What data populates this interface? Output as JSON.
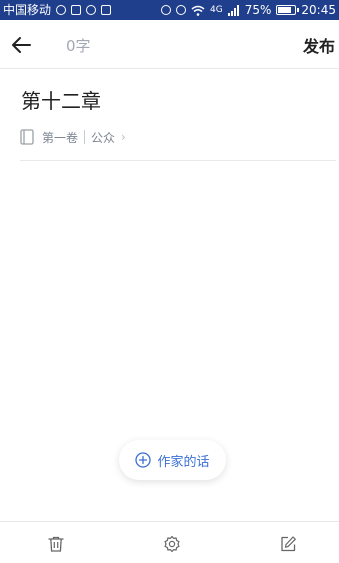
{
  "status_bar": {
    "carrier": "中国移动",
    "signal": "4G",
    "battery": "75%",
    "time": "20:45"
  },
  "top_bar": {
    "word_count": "0字",
    "publish_label": "发布"
  },
  "chapter": {
    "title": "第十二章",
    "volume": "第一卷",
    "visibility": "公众"
  },
  "author_words": {
    "label": "作家的话"
  },
  "colors": {
    "status_bar": "#1f3f8c",
    "accent": "#3a6fd8",
    "muted_text": "#a3a9b3"
  },
  "icons": {
    "back": "arrow-left-icon",
    "book": "book-icon",
    "chevron": "chevron-right-icon",
    "plus": "plus-circle-icon",
    "delete": "trash-icon",
    "settings": "gear-icon",
    "edit": "edit-icon"
  }
}
